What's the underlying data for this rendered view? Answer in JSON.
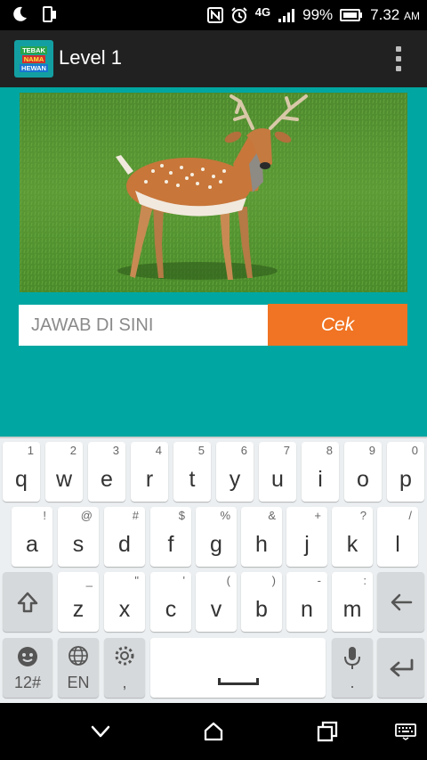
{
  "status_bar": {
    "network": "4G",
    "battery_percent": "99%",
    "time": "7.32",
    "time_suffix": "AM",
    "icons": [
      "moon-icon",
      "phone-screen-icon",
      "nfc-icon",
      "alarm-icon",
      "signal-icon",
      "battery-icon"
    ]
  },
  "app_bar": {
    "logo_lines": [
      "TEBAK",
      "NAMA",
      "HEWAN"
    ],
    "title": "Level 1",
    "menu_icon": "overflow-menu-icon"
  },
  "game": {
    "image_subject": "deer",
    "answer_placeholder": "JAWAB DI SINI",
    "answer_value": "",
    "check_label": "Cek"
  },
  "keyboard": {
    "row1": [
      {
        "key": "q",
        "hint": "1"
      },
      {
        "key": "w",
        "hint": "2"
      },
      {
        "key": "e",
        "hint": "3"
      },
      {
        "key": "r",
        "hint": "4"
      },
      {
        "key": "t",
        "hint": "5"
      },
      {
        "key": "y",
        "hint": "6"
      },
      {
        "key": "u",
        "hint": "7"
      },
      {
        "key": "i",
        "hint": "8"
      },
      {
        "key": "o",
        "hint": "9"
      },
      {
        "key": "p",
        "hint": "0"
      }
    ],
    "row2": [
      {
        "key": "a",
        "hint": "!"
      },
      {
        "key": "s",
        "hint": "@"
      },
      {
        "key": "d",
        "hint": "#"
      },
      {
        "key": "f",
        "hint": "$"
      },
      {
        "key": "g",
        "hint": "%"
      },
      {
        "key": "h",
        "hint": "&"
      },
      {
        "key": "j",
        "hint": "+"
      },
      {
        "key": "k",
        "hint": "?"
      },
      {
        "key": "l",
        "hint": "/"
      }
    ],
    "row3": [
      {
        "key": "z",
        "hint": "_"
      },
      {
        "key": "x",
        "hint": "\""
      },
      {
        "key": "c",
        "hint": "'"
      },
      {
        "key": "v",
        "hint": "("
      },
      {
        "key": "b",
        "hint": ")"
      },
      {
        "key": "n",
        "hint": "-"
      },
      {
        "key": "m",
        "hint": ":"
      }
    ],
    "symbols_label": "12#",
    "language_label": "EN",
    "comma_label": ",",
    "period_label": ".",
    "colors": {
      "accent": "#F07423",
      "background": "#00A6A1"
    }
  },
  "nav_bar": {
    "icons": [
      "back-icon",
      "home-icon",
      "recents-icon",
      "keyboard-switch-icon"
    ]
  }
}
